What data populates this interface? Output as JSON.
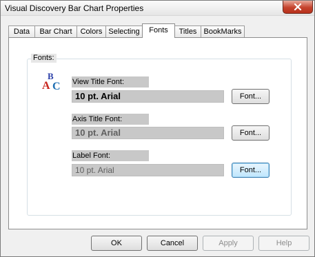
{
  "window": {
    "title": "Visual Discovery Bar Chart Properties"
  },
  "tabs": [
    {
      "label": "Data"
    },
    {
      "label": "Bar Chart"
    },
    {
      "label": "Colors"
    },
    {
      "label": "Selecting"
    },
    {
      "label": "Fonts"
    },
    {
      "label": "Titles"
    },
    {
      "label": "BookMarks"
    }
  ],
  "active_tab": "Fonts",
  "fonts_group": {
    "label": "Fonts:",
    "fields": [
      {
        "label": "View Title Font:",
        "value": "10 pt. Arial",
        "button": "Font..."
      },
      {
        "label": "Axis Title Font:",
        "value": "10 pt. Arial",
        "button": "Font..."
      },
      {
        "label": "Label Font:",
        "value": "10 pt. Arial",
        "button": "Font..."
      }
    ]
  },
  "footer": {
    "ok": "OK",
    "cancel": "Cancel",
    "apply": "Apply",
    "help": "Help"
  },
  "colors": {
    "close_button": "#c5432d",
    "field_bg": "#c8c8c8",
    "focus_border": "#3c7fb1"
  }
}
